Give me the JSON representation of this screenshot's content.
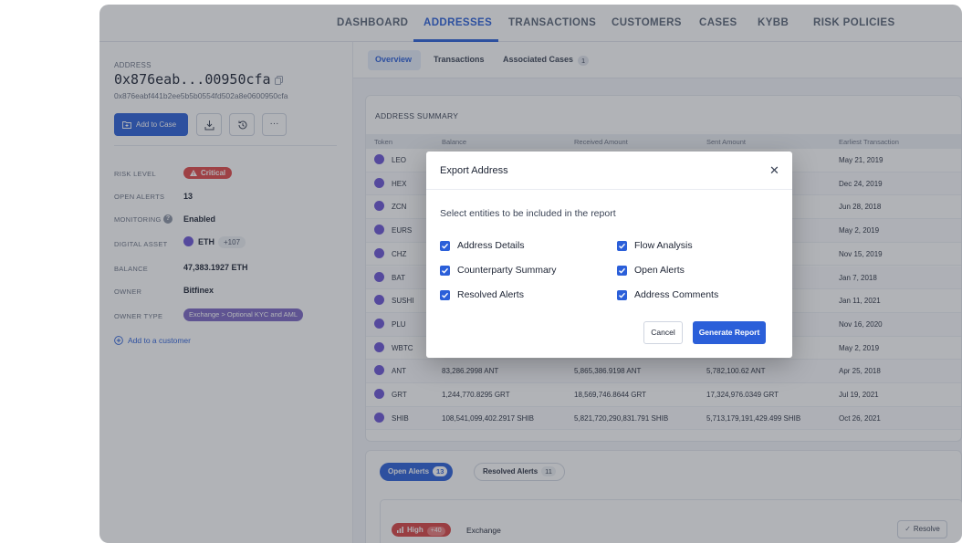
{
  "nav": {
    "items": [
      "DASHBOARD",
      "ADDRESSES",
      "TRANSACTIONS",
      "CUSTOMERS",
      "CASES",
      "KYBB",
      "RISK POLICIES"
    ],
    "active": "ADDRESSES"
  },
  "address": {
    "label": "ADDRESS",
    "short": "0x876eab...00950cfa",
    "full": "0x876eabf441b2ee5b5b0554fd502a8e0600950cfa"
  },
  "actions": {
    "add_to_case": "Add to Case",
    "more": "···"
  },
  "details": {
    "risk_level_label": "RISK LEVEL",
    "risk_level_value": "Critical",
    "open_alerts_label": "OPEN ALERTS",
    "open_alerts_value": "13",
    "monitoring_label": "MONITORING",
    "monitoring_help": "?",
    "monitoring_value": "Enabled",
    "digital_asset_label": "DIGITAL ASSET",
    "digital_asset_value": "ETH",
    "digital_asset_more": "+107",
    "balance_label": "BALANCE",
    "balance_value": "47,383.1927 ETH",
    "owner_label": "OWNER",
    "owner_value": "Bitfinex",
    "owner_type_label": "OWNER TYPE",
    "owner_type_value": "Exchange > Optional KYC and AML",
    "add_customer": "Add to a customer"
  },
  "subtabs": {
    "items": [
      "Overview",
      "Transactions",
      "Associated Cases"
    ],
    "associated_cases_count": "1",
    "active": "Overview"
  },
  "summary": {
    "title": "ADDRESS SUMMARY",
    "columns": [
      "Token",
      "Balance",
      "Received Amount",
      "Sent Amount",
      "Earliest Transaction"
    ],
    "rows": [
      {
        "token": "LEO",
        "balance": "",
        "received": "",
        "sent": "",
        "earliest": "May 21, 2019"
      },
      {
        "token": "HEX",
        "balance": "",
        "received": "",
        "sent": "",
        "earliest": "Dec 24, 2019"
      },
      {
        "token": "ZCN",
        "balance": "",
        "received": "",
        "sent": "",
        "earliest": "Jun 28, 2018"
      },
      {
        "token": "EURS",
        "balance": "",
        "received": "",
        "sent": "",
        "earliest": "May 2, 2019"
      },
      {
        "token": "CHZ",
        "balance": "",
        "received": "",
        "sent": "",
        "earliest": "Nov 15, 2019"
      },
      {
        "token": "BAT",
        "balance": "",
        "received": "",
        "sent": "",
        "earliest": "Jan 7, 2018"
      },
      {
        "token": "SUSHI",
        "balance": "",
        "received": "",
        "sent": "",
        "earliest": "Jan 11, 2021"
      },
      {
        "token": "PLU",
        "balance": "",
        "received": "",
        "sent": "",
        "earliest": "Nov 16, 2020"
      },
      {
        "token": "WBTC",
        "balance": "",
        "received": "",
        "sent": "",
        "earliest": "May 2, 2019"
      },
      {
        "token": "ANT",
        "balance": "83,286.2998 ANT",
        "received": "5,865,386.9198 ANT",
        "sent": "5,782,100.62 ANT",
        "earliest": "Apr 25, 2018"
      },
      {
        "token": "GRT",
        "balance": "1,244,770.8295 GRT",
        "received": "18,569,746.8644 GRT",
        "sent": "17,324,976.0349 GRT",
        "earliest": "Jul 19, 2021"
      },
      {
        "token": "SHIB",
        "balance": "108,541,099,402.2917 SHIB",
        "received": "5,821,720,290,831.791 SHIB",
        "sent": "5,713,179,191,429.499 SHIB",
        "earliest": "Oct 26, 2021"
      }
    ]
  },
  "alerts": {
    "open_label": "Open Alerts",
    "open_count": "13",
    "resolved_label": "Resolved Alerts",
    "resolved_count": "11",
    "item": {
      "severity": "High",
      "score": "+40",
      "category": "Exchange",
      "resolve": "Resolve"
    }
  },
  "modal": {
    "title": "Export Address",
    "subtitle": "Select entities to be included in the report",
    "options_left": [
      "Address Details",
      "Counterparty Summary",
      "Resolved Alerts"
    ],
    "options_right": [
      "Flow Analysis",
      "Open Alerts",
      "Address Comments"
    ],
    "cancel": "Cancel",
    "generate": "Generate Report"
  },
  "colors": {
    "accent": "#2b5fd9",
    "critical": "#e04848",
    "owner_type": "#7b67c4",
    "token_icon": "#6b55d6"
  }
}
